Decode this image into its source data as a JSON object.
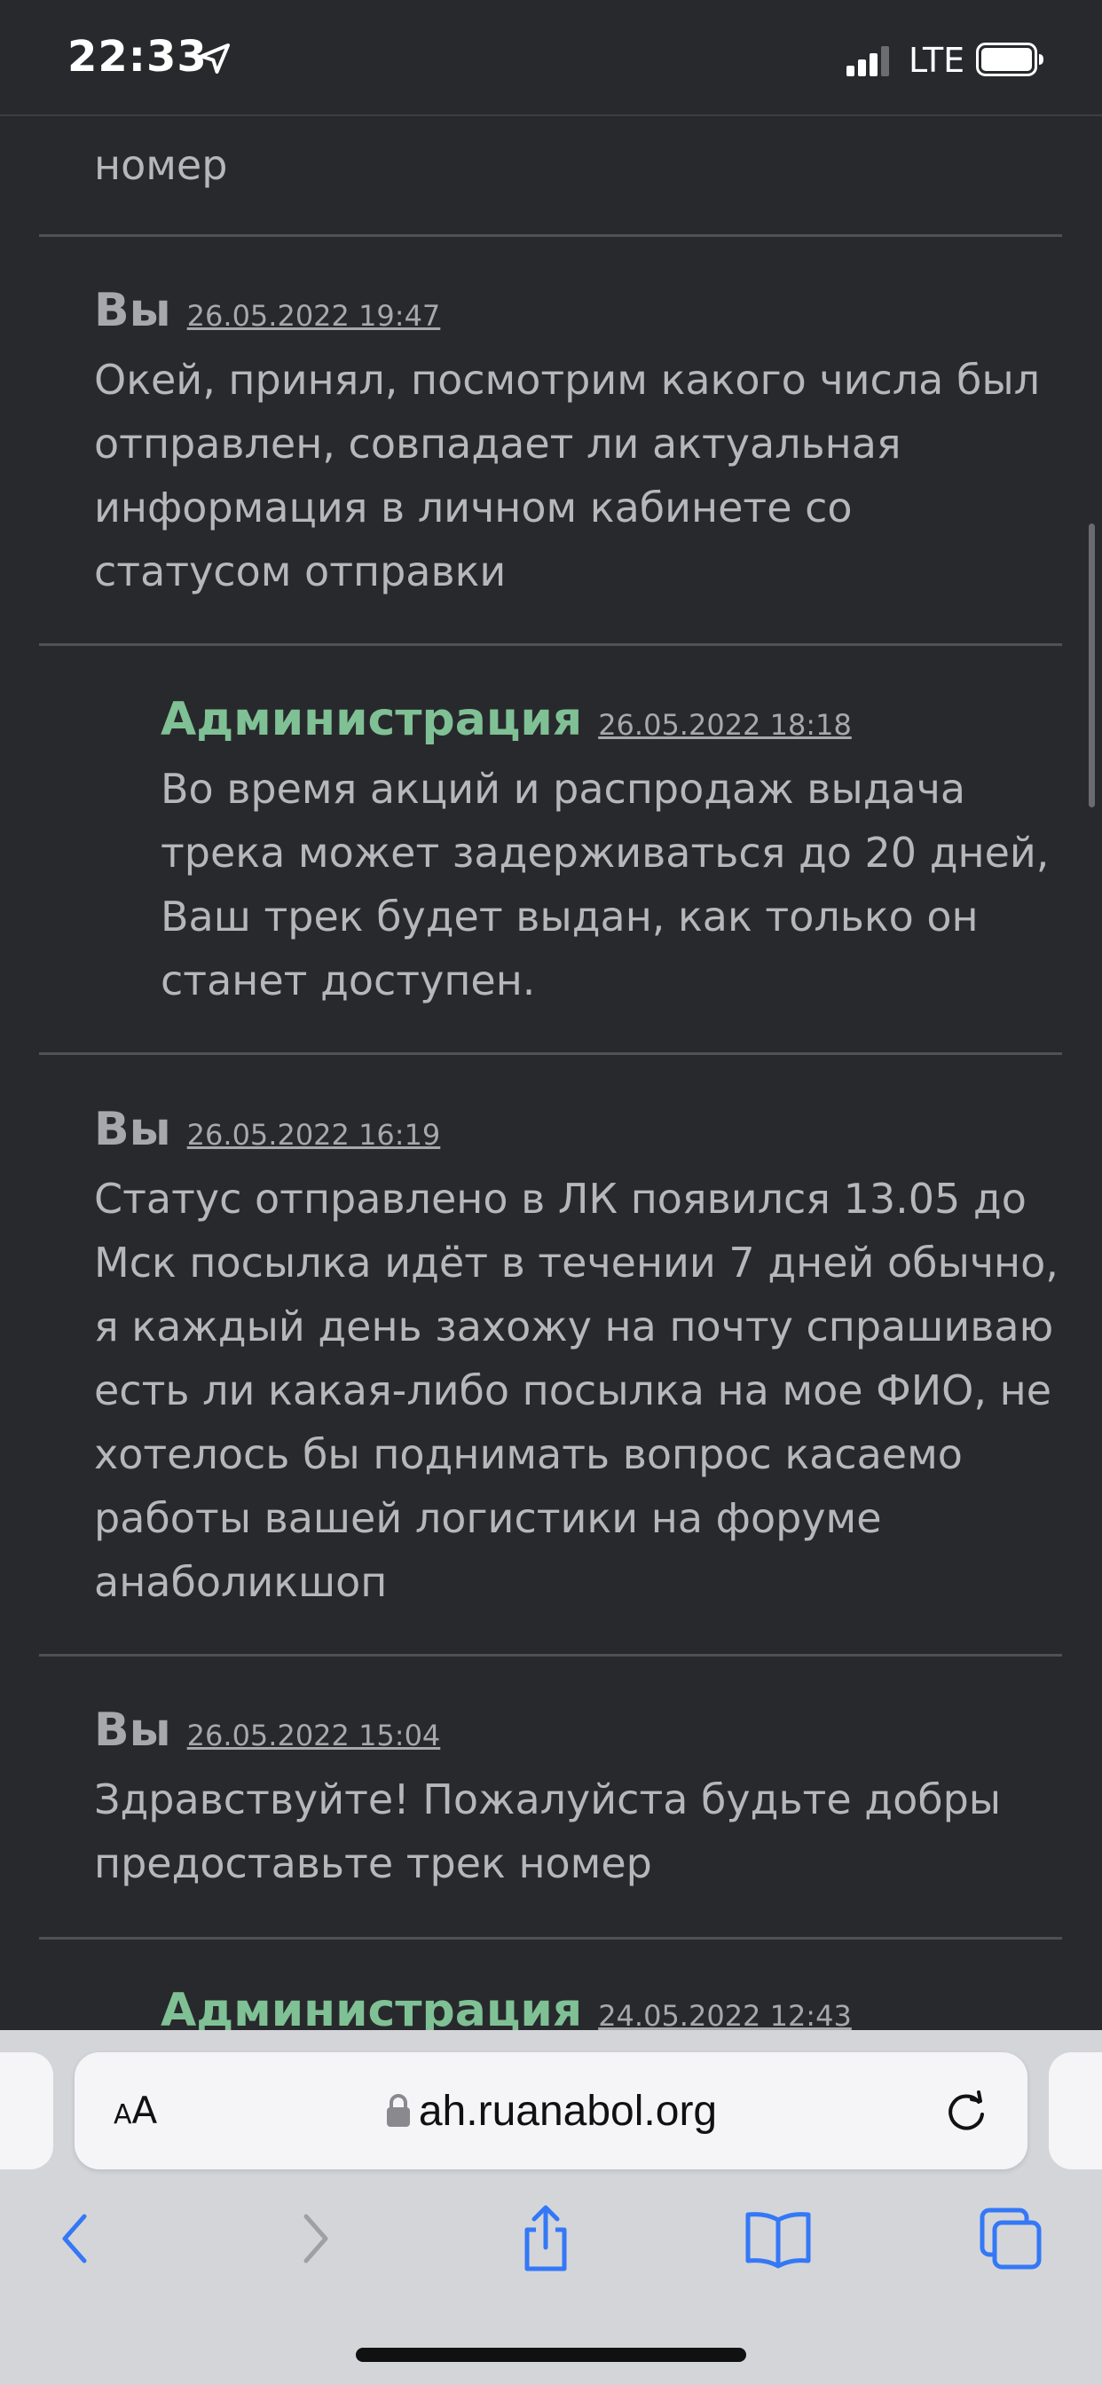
{
  "status_bar": {
    "time": "22:33",
    "network": "LTE",
    "icons": [
      "location-arrow-icon",
      "signal-bars-icon",
      "battery-icon"
    ]
  },
  "feed": {
    "partial_top_text": "номер",
    "messages": [
      {
        "author": "Вы",
        "date": "26.05.2022 19:47",
        "role": "user",
        "text": "Окей, принял, посмотрим какого числа был отправлен, совпадает ли актуальная информация в личном кабинете со статусом отправки"
      },
      {
        "author": "Администрация",
        "date": "26.05.2022 18:18",
        "role": "admin",
        "text": "Во время акций и распродаж выдача трека может задерживаться до 20 дней, Ваш трек будет выдан, как только он станет доступен."
      },
      {
        "author": "Вы",
        "date": "26.05.2022 16:19",
        "role": "user",
        "text": "Статус отправлено в ЛК появился 13.05 до Мск посылка идёт в течении 7 дней обычно, я каждый день захожу на почту спрашиваю есть ли какая-либо посылка на мое ФИО, не хотелось бы поднимать вопрос касаемо работы вашей логистики на форуме анаболикшоп"
      },
      {
        "author": "Вы",
        "date": "26.05.2022 15:04",
        "role": "user",
        "text": "Здравствуйте! Пожалуйста будьте добры предоставьте трек номер"
      },
      {
        "author": "Администрация",
        "date": "24.05.2022 12:43",
        "role": "admin",
        "text": ""
      }
    ]
  },
  "browser": {
    "reader_label_small": "A",
    "reader_label_large": "A",
    "url": "ah.ruanabol.org",
    "toolbar_icons": [
      "back-icon",
      "forward-icon",
      "share-icon",
      "bookmarks-icon",
      "tabs-icon"
    ]
  },
  "colors": {
    "background": "#28292d",
    "text": "#b6b7bb",
    "admin_accent": "#7fc195",
    "browser_chrome": "#d4d5d9",
    "toolbar_accent": "#3478f6"
  }
}
